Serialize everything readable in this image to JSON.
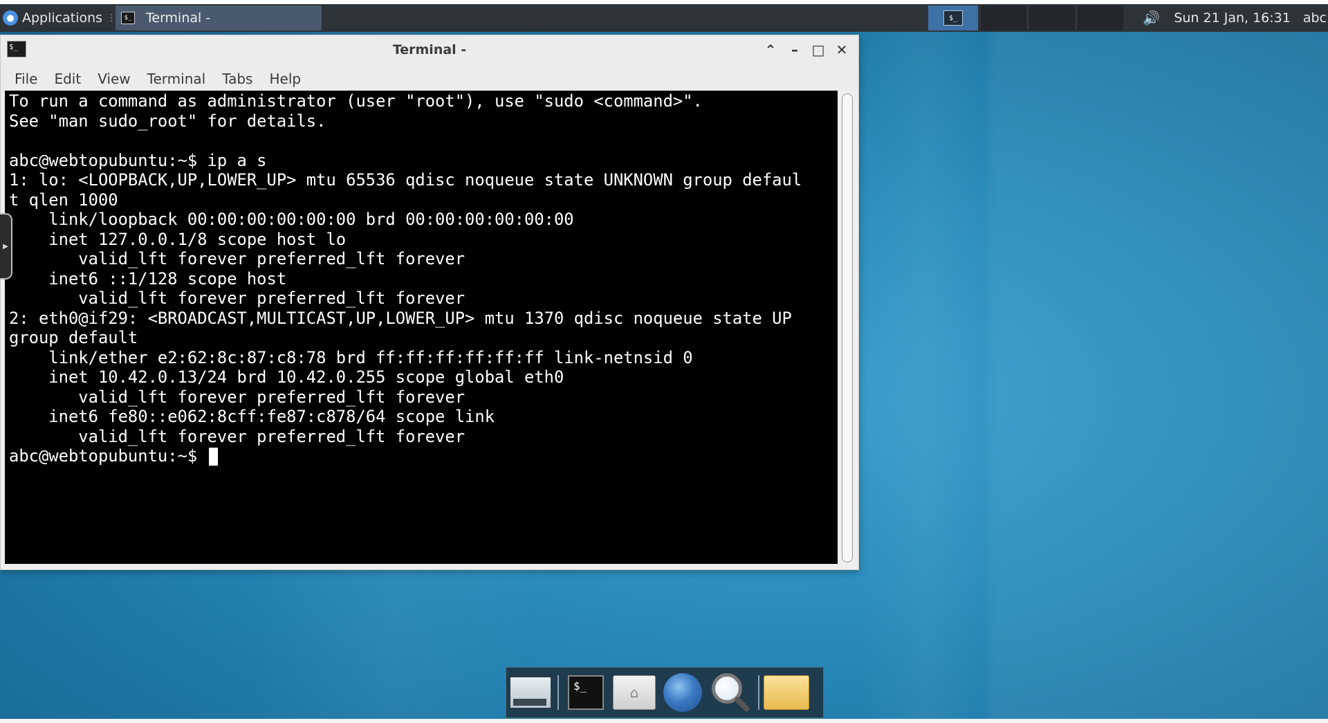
{
  "top_panel": {
    "applications_label": "Applications",
    "task_title": "Terminal -",
    "clock": "Sun 21 Jan, 16:31",
    "user": "abc",
    "volume_icon": "volume-icon"
  },
  "window": {
    "title": "Terminal -",
    "menu": [
      "File",
      "Edit",
      "View",
      "Terminal",
      "Tabs",
      "Help"
    ],
    "buttons": [
      "maximize-up-icon",
      "minimize-icon",
      "maximize-icon",
      "close-icon"
    ]
  },
  "terminal": {
    "lines": [
      "To run a command as administrator (user \"root\"), use \"sudo <command>\".",
      "See \"man sudo_root\" for details.",
      "",
      "abc@webtopubuntu:~$ ip a s",
      "1: lo: <LOOPBACK,UP,LOWER_UP> mtu 65536 qdisc noqueue state UNKNOWN group defaul",
      "t qlen 1000",
      "    link/loopback 00:00:00:00:00:00 brd 00:00:00:00:00:00",
      "    inet 127.0.0.1/8 scope host lo",
      "       valid_lft forever preferred_lft forever",
      "    inet6 ::1/128 scope host",
      "       valid_lft forever preferred_lft forever",
      "2: eth0@if29: <BROADCAST,MULTICAST,UP,LOWER_UP> mtu 1370 qdisc noqueue state UP",
      "group default",
      "    link/ether e2:62:8c:87:c8:78 brd ff:ff:ff:ff:ff:ff link-netnsid 0",
      "    inet 10.42.0.13/24 brd 10.42.0.255 scope global eth0",
      "       valid_lft forever preferred_lft forever",
      "    inet6 fe80::e062:8cff:fe87:c878/64 scope link",
      "       valid_lft forever preferred_lft forever"
    ],
    "prompt": "abc@webtopubuntu:~$ "
  },
  "dock": {
    "items": [
      "show-desktop-icon",
      "terminal-icon",
      "home-folder-icon",
      "web-browser-icon",
      "search-icon",
      "folder-icon"
    ],
    "terminal_glyph": "$_"
  },
  "colors": {
    "panel_bg": "#2e3338",
    "desktop_bg": "#2b8fbf",
    "terminal_bg": "#000000",
    "terminal_fg": "#ffffff",
    "task_active": "#4a5a6e",
    "workspace_active": "#3e72a6"
  }
}
